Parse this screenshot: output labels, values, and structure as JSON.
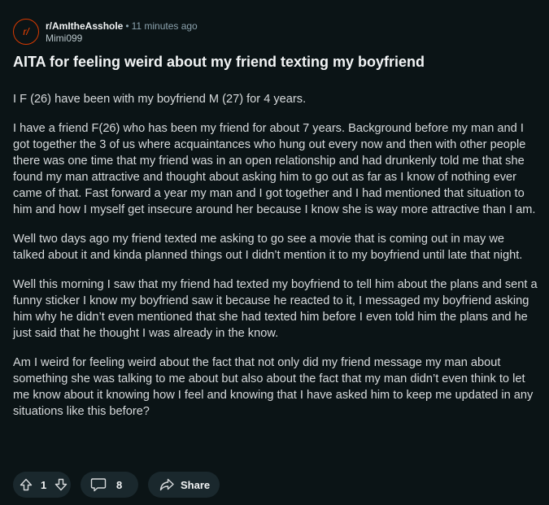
{
  "post": {
    "subreddit": "r/AmItheAsshole",
    "subreddit_avatar": "r/",
    "time_ago": "11 minutes ago",
    "author": "Mimi099",
    "title": "AITA for feeling weird about my friend texting my boyfriend",
    "paragraphs": [
      "I F (26) have been with my boyfriend M (27) for 4 years.",
      "I have a friend F(26) who has been my friend for about 7 years. Background before my man and I got together the 3 of us where acquaintances who hung out every now and then with other people there was one time that my friend was in an open relationship and had drunkenly told me that she found my man attractive and thought about asking him to go out as far as I know of nothing ever came of that. Fast forward a year my man and I got together and I had mentioned that situation to him and how I myself get insecure around her because I know she is way more attractive than I am.",
      "Well two days ago my friend texted me asking to go see a movie that is coming out in may we talked about it and kinda planned things out I didn’t mention it to my boyfriend until late that night.",
      "Well this morning I saw that my friend had texted my boyfriend to tell him about the plans and sent a funny sticker I know my boyfriend saw it because he reacted to it, I messaged my boyfriend asking him why he didn’t even mentioned that she had texted him before I even told him the plans and he just said that he thought I was already in the know.",
      "Am I weird for feeling weird about the fact that not only did my friend message my man about something she was talking to me about but also about the fact that my man didn’t even think to let me know about it knowing how I feel and knowing that I have asked him to keep me updated in any situations like this before?"
    ]
  },
  "actions": {
    "vote_count": "1",
    "comment_count": "8",
    "share_label": "Share",
    "icons": {
      "upvote": "upvote-arrow-icon",
      "downvote": "downvote-arrow-icon",
      "comment": "comment-bubble-icon",
      "share": "share-arrow-icon"
    }
  },
  "colors": {
    "background": "#0b1416",
    "pill": "#1a282d",
    "text": "#d7dadc",
    "title": "#f2f4f5",
    "muted": "#8ba2ad",
    "accent": "#ff4500"
  }
}
